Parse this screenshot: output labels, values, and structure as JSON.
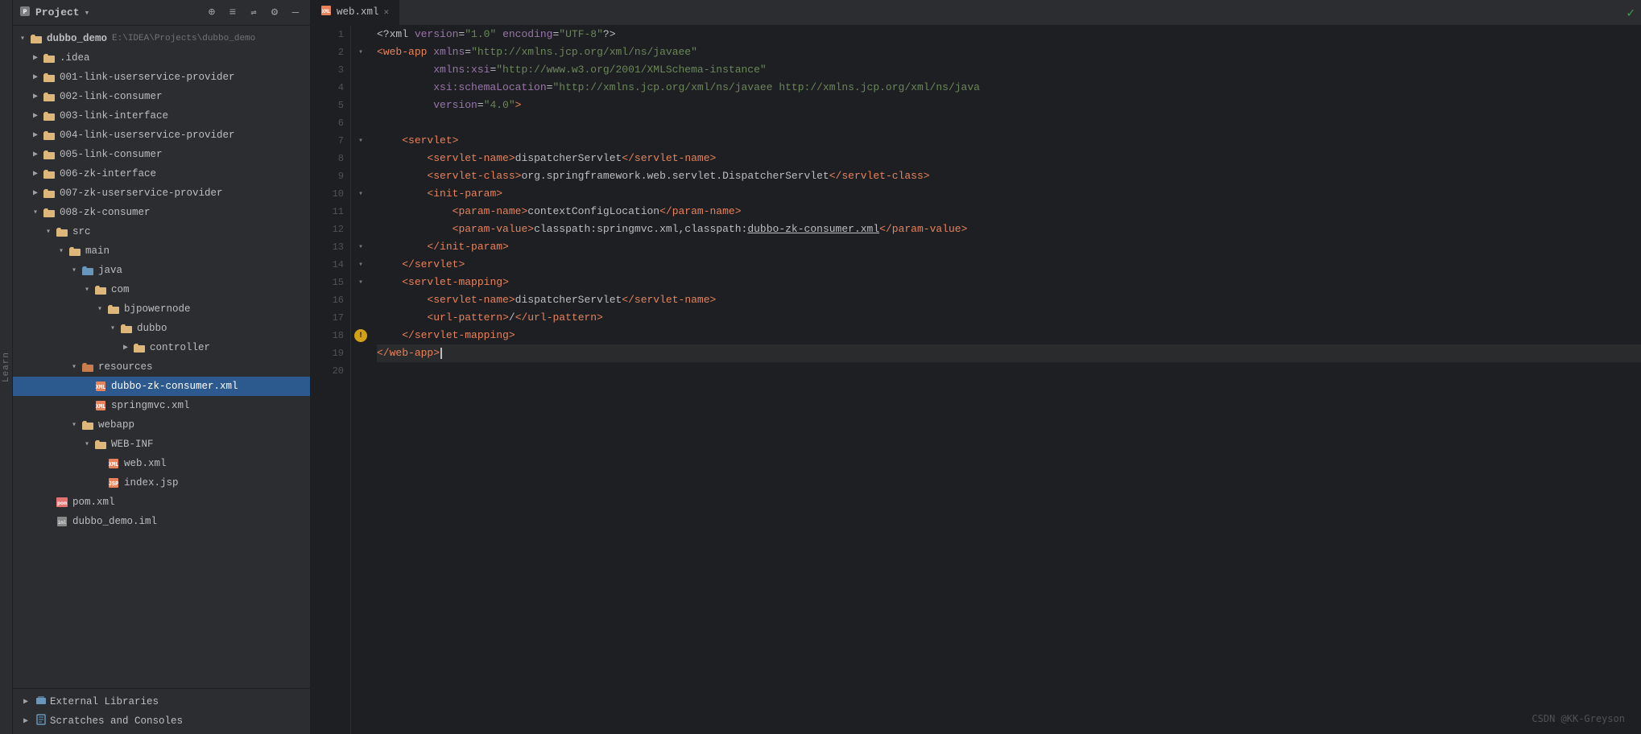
{
  "sidebar": {
    "header": {
      "title": "Project",
      "dropdown_icon": "▾"
    },
    "toolbar_icons": [
      "⊕",
      "≡",
      "⇌",
      "⚙",
      "—"
    ],
    "tree": [
      {
        "id": "dubbo_demo_root",
        "label": "dubbo_demo",
        "subtitle": "E:\\IDEA\\Projects\\dubbo_demo",
        "indent": 0,
        "type": "module",
        "expanded": true,
        "arrow": "▾"
      },
      {
        "id": "idea",
        "label": ".idea",
        "indent": 1,
        "type": "folder",
        "expanded": false,
        "arrow": "▶"
      },
      {
        "id": "001",
        "label": "001-link-userservice-provider",
        "indent": 1,
        "type": "folder",
        "expanded": false,
        "arrow": "▶"
      },
      {
        "id": "002",
        "label": "002-link-consumer",
        "indent": 1,
        "type": "folder",
        "expanded": false,
        "arrow": "▶"
      },
      {
        "id": "003",
        "label": "003-link-interface",
        "indent": 1,
        "type": "folder",
        "expanded": false,
        "arrow": "▶"
      },
      {
        "id": "004",
        "label": "004-link-userservice-provider",
        "indent": 1,
        "type": "folder",
        "expanded": false,
        "arrow": "▶"
      },
      {
        "id": "005",
        "label": "005-link-consumer",
        "indent": 1,
        "type": "folder",
        "expanded": false,
        "arrow": "▶"
      },
      {
        "id": "006",
        "label": "006-zk-interface",
        "indent": 1,
        "type": "folder",
        "expanded": false,
        "arrow": "▶"
      },
      {
        "id": "007",
        "label": "007-zk-userservice-provider",
        "indent": 1,
        "type": "folder",
        "expanded": false,
        "arrow": "▶"
      },
      {
        "id": "008",
        "label": "008-zk-consumer",
        "indent": 1,
        "type": "folder",
        "expanded": true,
        "arrow": "▾"
      },
      {
        "id": "src",
        "label": "src",
        "indent": 2,
        "type": "folder",
        "expanded": true,
        "arrow": "▾"
      },
      {
        "id": "main",
        "label": "main",
        "indent": 3,
        "type": "folder",
        "expanded": true,
        "arrow": "▾"
      },
      {
        "id": "java",
        "label": "java",
        "indent": 4,
        "type": "folder-src",
        "expanded": true,
        "arrow": "▾"
      },
      {
        "id": "com",
        "label": "com",
        "indent": 5,
        "type": "folder",
        "expanded": true,
        "arrow": "▾"
      },
      {
        "id": "bjpowernode",
        "label": "bjpowernode",
        "indent": 6,
        "type": "folder",
        "expanded": true,
        "arrow": "▾"
      },
      {
        "id": "dubbo",
        "label": "dubbo",
        "indent": 7,
        "type": "folder",
        "expanded": true,
        "arrow": "▾"
      },
      {
        "id": "controller",
        "label": "controller",
        "indent": 8,
        "type": "folder",
        "expanded": false,
        "arrow": "▶"
      },
      {
        "id": "resources",
        "label": "resources",
        "indent": 4,
        "type": "folder-res",
        "expanded": true,
        "arrow": "▾"
      },
      {
        "id": "dubbo-zk-consumer",
        "label": "dubbo-zk-consumer.xml",
        "indent": 5,
        "type": "xml",
        "selected": true
      },
      {
        "id": "springmvc",
        "label": "springmvc.xml",
        "indent": 5,
        "type": "xml"
      },
      {
        "id": "webapp",
        "label": "webapp",
        "indent": 4,
        "type": "folder",
        "expanded": true,
        "arrow": "▾"
      },
      {
        "id": "web-inf",
        "label": "WEB-INF",
        "indent": 5,
        "type": "folder",
        "expanded": true,
        "arrow": "▾"
      },
      {
        "id": "web-xml",
        "label": "web.xml",
        "indent": 6,
        "type": "xml"
      },
      {
        "id": "index-jsp",
        "label": "index.jsp",
        "indent": 6,
        "type": "jsp"
      },
      {
        "id": "pom",
        "label": "pom.xml",
        "indent": 2,
        "type": "pom"
      },
      {
        "id": "dubbo-demo-iml",
        "label": "dubbo_demo.iml",
        "indent": 2,
        "type": "iml"
      }
    ],
    "bottom_items": [
      {
        "id": "ext-libs",
        "label": "External Libraries",
        "icon": "libs"
      },
      {
        "id": "scratches",
        "label": "Scratches and Consoles",
        "icon": "scratches"
      }
    ]
  },
  "editor": {
    "tab": {
      "filename": "web.xml",
      "icon": "xml",
      "close_btn": "✕"
    },
    "lines": [
      {
        "num": 1,
        "content": "<?xml version=\"1.0\" encoding=\"UTF-8\"?>",
        "type": "decl"
      },
      {
        "num": 2,
        "content": "<web-app xmlns=\"http://xmlns.jcp.org/xml/ns/javaee\"",
        "type": "tag-open",
        "foldable": true
      },
      {
        "num": 3,
        "content": "         xmlns:xsi=\"http://www.w3.org/2001/XMLSchema-instance\"",
        "type": "attr"
      },
      {
        "num": 4,
        "content": "         xsi:schemaLocation=\"http://xmlns.jcp.org/xml/ns/javaee http://xmlns.jcp.org/xml/ns/java",
        "type": "attr"
      },
      {
        "num": 5,
        "content": "         version=\"4.0\">",
        "type": "attr"
      },
      {
        "num": 6,
        "content": "",
        "type": "empty"
      },
      {
        "num": 7,
        "content": "    <servlet>",
        "type": "tag-open",
        "foldable": true
      },
      {
        "num": 8,
        "content": "        <servlet-name>dispatcherServlet</servlet-name>",
        "type": "tag"
      },
      {
        "num": 9,
        "content": "        <servlet-class>org.springframework.web.servlet.DispatcherServlet</servlet-class>",
        "type": "tag"
      },
      {
        "num": 10,
        "content": "        <init-param>",
        "type": "tag-open",
        "foldable": true
      },
      {
        "num": 11,
        "content": "            <param-name>contextConfigLocation</param-name>",
        "type": "tag"
      },
      {
        "num": 12,
        "content": "            <param-value>classpath:springmvc.xml,classpath:dubbo-zk-consumer.xml</param-value>",
        "type": "tag"
      },
      {
        "num": 13,
        "content": "        </init-param>",
        "type": "tag-close",
        "foldable": true
      },
      {
        "num": 14,
        "content": "    </servlet>",
        "type": "tag-close",
        "foldable": true
      },
      {
        "num": 15,
        "content": "    <servlet-mapping>",
        "type": "tag-open",
        "foldable": true
      },
      {
        "num": 16,
        "content": "        <servlet-name>dispatcherServlet</servlet-name>",
        "type": "tag"
      },
      {
        "num": 17,
        "content": "        <url-pattern>/</url-pattern>",
        "type": "tag"
      },
      {
        "num": 18,
        "content": "    </servlet-mapping>",
        "type": "tag-close",
        "foldable": true,
        "has_hint": true
      },
      {
        "num": 19,
        "content": "</web-app>",
        "type": "tag-close",
        "is_current": true
      },
      {
        "num": 20,
        "content": "",
        "type": "empty"
      }
    ]
  },
  "watermark": "CSDN @KK-Greyson",
  "learn_bar": "Learn"
}
